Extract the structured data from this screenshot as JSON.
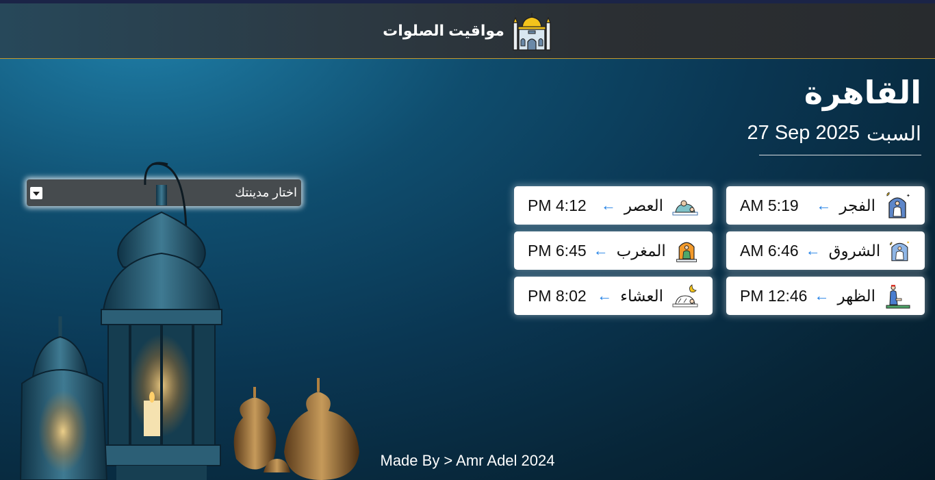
{
  "header": {
    "title": "مواقيت الصلوات",
    "logo_icon": "mosque-icon"
  },
  "city": {
    "name": "القاهرة",
    "day": "السبت",
    "date": "27 Sep 2025"
  },
  "selector": {
    "placeholder": "اختار مدينتك"
  },
  "prayers": [
    {
      "name": "الفجر",
      "time": "AM 5:19",
      "icon": "night-prayer-icon"
    },
    {
      "name": "العصر",
      "time": "PM 4:12",
      "icon": "prostration-icon"
    },
    {
      "name": "الشروق",
      "time": "AM 6:46",
      "icon": "sunrise-prayer-icon"
    },
    {
      "name": "المغرب",
      "time": "PM 6:45",
      "icon": "sunset-prayer-icon"
    },
    {
      "name": "الظهر",
      "time": "PM 12:46",
      "icon": "noon-prayer-icon"
    },
    {
      "name": "العشاء",
      "time": "PM 8:02",
      "icon": "moon-prayer-icon"
    }
  ],
  "arrow_glyph": "←",
  "footer": {
    "text": "Made By > Amr Adel 2024"
  },
  "colors": {
    "arrow": "#1f7fe6",
    "header_border": "#c69a2c"
  }
}
